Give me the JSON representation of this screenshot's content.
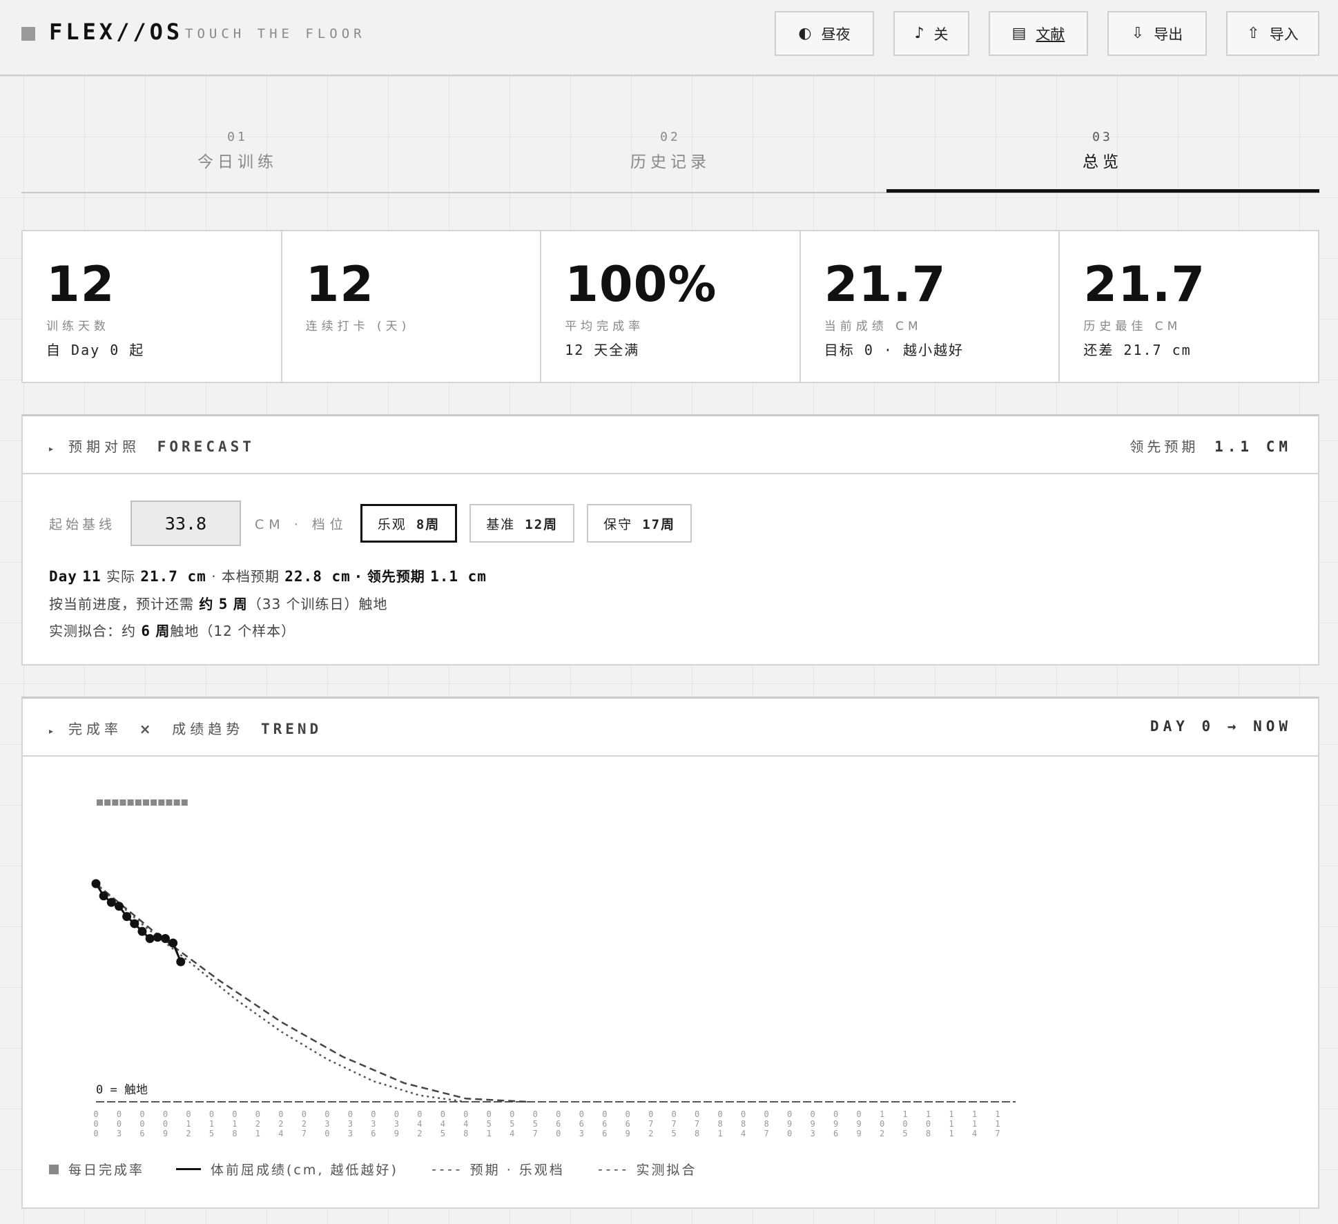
{
  "header": {
    "brand": "FLEX//OS",
    "tagline": "TOUCH THE FLOOR",
    "buttons": [
      {
        "icon": "◐",
        "label": "昼夜"
      },
      {
        "icon": "♪",
        "label": "关"
      },
      {
        "icon": "▤",
        "label": "文献"
      },
      {
        "icon": "⇩",
        "label": "导出"
      },
      {
        "icon": "⇧",
        "label": "导入"
      }
    ]
  },
  "tabs": [
    {
      "num": "01",
      "label": "今日训练",
      "active": false
    },
    {
      "num": "02",
      "label": "历史记录",
      "active": false
    },
    {
      "num": "03",
      "label": "总览",
      "active": true
    }
  ],
  "stats": [
    {
      "value": "12",
      "label": "训练天数",
      "sub": "自 Day 0 起"
    },
    {
      "value": "12",
      "label": "连续打卡 (天)",
      "sub": ""
    },
    {
      "value": "100%",
      "label": "平均完成率",
      "sub": "12 天全满"
    },
    {
      "value": "21.7",
      "label": "当前成绩 CM",
      "sub": "目标 0 · 越小越好"
    },
    {
      "value": "21.7",
      "label": "历史最佳 CM",
      "sub": "还差 21.7 cm"
    }
  ],
  "forecast": {
    "title_cn": "预期对照",
    "title_en": "FORECAST",
    "right_label": "领先预期",
    "right_value": "1.1 CM",
    "baseline_label": "起始基线",
    "baseline_value": "33.8",
    "unit_label": "CM · 档位",
    "options": [
      {
        "name": "乐观",
        "weeks": "8周",
        "active": true
      },
      {
        "name": "基准",
        "weeks": "12周",
        "active": false
      },
      {
        "name": "保守",
        "weeks": "17周",
        "active": false
      }
    ],
    "line1": {
      "day_label": "Day",
      "day_value": "11",
      "actual_label": "实际",
      "actual_value": "21.7 cm",
      "expected_label": "· 本档预期",
      "expected_value": "22.8 cm",
      "lead_label": "· 领先预期",
      "lead_value": "1.1 cm"
    },
    "line2": {
      "prefix": "按当前进度，预计还需",
      "approx": "约",
      "weeks_value": "5",
      "weeks_unit": "周",
      "paren_open": "（33",
      "paren_rest": "个训练日）触地"
    },
    "line3": {
      "prefix": "实测拟合：约",
      "weeks_value": "6",
      "weeks_unit": "周",
      "suffix_a": "触地（12",
      "suffix_b": "个样本）"
    }
  },
  "trend": {
    "title_cn_a": "完成率",
    "title_x": "×",
    "title_cn_b": "成绩趋势",
    "title_en": "TREND",
    "right_label": "DAY 0 → NOW",
    "zero_label": "0 = 触地",
    "legend": [
      {
        "kind": "square",
        "label": "每日完成率"
      },
      {
        "kind": "line",
        "label": "体前屈成绩(cm, 越低越好)"
      },
      {
        "kind": "dash",
        "marker": "----",
        "label": "预期 · 乐观档"
      },
      {
        "kind": "dash",
        "marker": "----",
        "label": "实测拟合"
      }
    ]
  },
  "chart_data": {
    "type": "line",
    "x_ticks": [
      "000",
      "003",
      "006",
      "009",
      "012",
      "015",
      "018",
      "021",
      "024",
      "027",
      "030",
      "033",
      "036",
      "039",
      "042",
      "045",
      "048",
      "051",
      "054",
      "057",
      "060",
      "063",
      "066",
      "069",
      "072",
      "075",
      "078",
      "081",
      "084",
      "087",
      "090",
      "093",
      "096",
      "099",
      "102",
      "105",
      "108",
      "111",
      "114",
      "117"
    ],
    "xlim": [
      0,
      117
    ],
    "ylim": [
      0,
      33.8
    ],
    "series": [
      {
        "name": "每日完成率",
        "x": [
          0,
          1,
          2,
          3,
          4,
          5,
          6,
          7,
          8,
          9,
          10,
          11
        ],
        "values": [
          100,
          100,
          100,
          100,
          100,
          100,
          100,
          100,
          100,
          100,
          100,
          100
        ]
      },
      {
        "name": "体前屈成绩",
        "x": [
          0,
          1,
          2,
          3,
          4,
          5,
          6,
          7,
          8,
          9,
          10,
          11
        ],
        "values": [
          33.8,
          31.9,
          30.9,
          30.3,
          28.7,
          27.6,
          26.4,
          25.3,
          25.5,
          25.3,
          24.6,
          21.7
        ]
      },
      {
        "name": "预期",
        "x": [
          0,
          8,
          16,
          24,
          32,
          40,
          48,
          56
        ],
        "values": [
          33.8,
          25.9,
          18.8,
          12.4,
          7.0,
          2.9,
          0.5,
          0
        ]
      },
      {
        "name": "实测拟合",
        "x": [
          0,
          6,
          12,
          18,
          24,
          30,
          36,
          42,
          48
        ],
        "values": [
          33.8,
          27.5,
          21.8,
          16.0,
          10.9,
          6.6,
          3.2,
          1.0,
          0
        ]
      }
    ]
  }
}
